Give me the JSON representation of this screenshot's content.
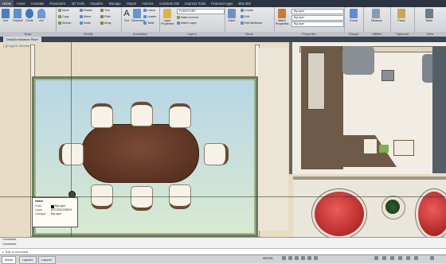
{
  "ribbon_tabs": [
    "Home",
    "Insert",
    "Annotate",
    "Parametric",
    "3D Tools",
    "Visualize",
    "Manage",
    "Output",
    "Add-ins",
    "Autodesk 360",
    "Express Tools",
    "Featured Apps",
    "BIM 360"
  ],
  "active_tab": "Home",
  "groups": {
    "draw": {
      "label": "Draw",
      "tools": [
        "Line",
        "Polyline",
        "Circle",
        "Arc"
      ]
    },
    "modify": {
      "label": "Modify",
      "tools": [
        "Move",
        "Rotate",
        "Trim",
        "Copy",
        "Mirror",
        "Fillet",
        "Stretch",
        "Scale",
        "Array"
      ]
    },
    "annotation": {
      "label": "Annotation",
      "tools": [
        "Text",
        "Dimension",
        "Linear",
        "Leader",
        "Table"
      ]
    },
    "layers": {
      "label": "Layers",
      "tools": [
        "Layer Properties",
        "Make Current",
        "Match Layer"
      ],
      "layer_value": "FURNITURE"
    },
    "block": {
      "label": "Block",
      "tools": [
        "Insert",
        "Create",
        "Edit",
        "Edit Attributes"
      ]
    },
    "properties": {
      "label": "Properties",
      "tools": [
        "Match Properties"
      ],
      "values": [
        "ByLayer",
        "ByLayer",
        "ByLayer"
      ]
    },
    "groups": {
      "label": "Groups",
      "tools": [
        "Group"
      ]
    },
    "utilities": {
      "label": "Utilities",
      "tools": [
        "Measure"
      ]
    },
    "clipboard": {
      "label": "Clipboard",
      "tools": [
        "Paste"
      ]
    },
    "view": {
      "label": "View",
      "tools": [
        "Base"
      ]
    }
  },
  "file_tab": "DrawDominance Plan*",
  "viewport_label": "[-][Top][2D Wireframe]",
  "tooltip": {
    "title": "Hatch",
    "rows": [
      {
        "k": "Color",
        "v": "ByLayer"
      },
      {
        "k": "Layer",
        "v": "ACCESSORIES"
      },
      {
        "k": "Linetype",
        "v": "ByLayer"
      }
    ]
  },
  "command": {
    "history": [
      "Command:",
      "Command:"
    ],
    "prompt": "Type a command"
  },
  "layout_tabs": [
    "Model",
    "Layout1",
    "Layout2"
  ],
  "status_model": "MODEL",
  "colors": {
    "accent": "#2b3440",
    "rug_border": "#6c7a60",
    "table": "#5a3322",
    "chair_accent": "#6a4a33",
    "red_chair": "#c62828"
  }
}
